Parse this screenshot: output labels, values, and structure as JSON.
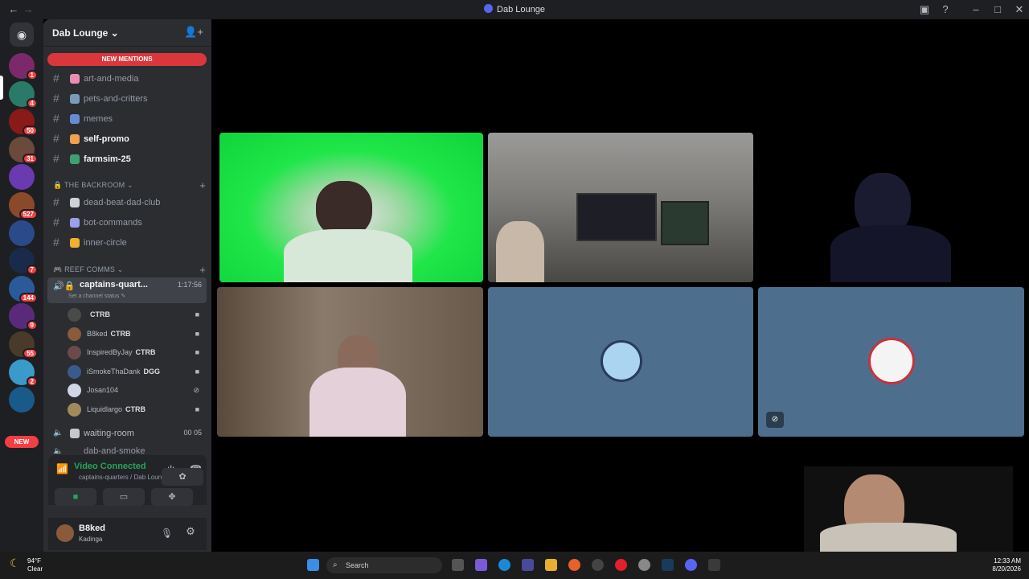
{
  "window": {
    "title": "Dab Lounge"
  },
  "servers": [
    {
      "badge": "1",
      "color": "#7a2a6a"
    },
    {
      "badge": "4",
      "color": "#2a7a6a"
    },
    {
      "badge": "50",
      "color": "#8a1a1a"
    },
    {
      "badge": "31",
      "color": "#6a4a3a"
    },
    {
      "badge": "",
      "color": "#6a3ab0"
    },
    {
      "badge": "527",
      "color": "#8a4a2a"
    },
    {
      "badge": "",
      "color": "#2a4a8a"
    },
    {
      "badge": "7",
      "color": "#1a2a4a"
    },
    {
      "badge": "144",
      "color": "#2a5a9a"
    },
    {
      "badge": "9",
      "color": "#5a2a7a"
    },
    {
      "badge": "55",
      "color": "#4a3a2a"
    },
    {
      "badge": "2",
      "color": "#3a9aca"
    },
    {
      "badge": "",
      "color": "#1a5a8a"
    }
  ],
  "rail": {
    "new_label": "NEW"
  },
  "guild": {
    "name": "Dab Lounge ⌄"
  },
  "new_mentions": "NEW MENTIONS",
  "channels_top": [
    {
      "name": "art-and-media",
      "emoji_color": "#e78fb3"
    },
    {
      "name": "pets-and-critters",
      "emoji_color": "#7a9ab8"
    },
    {
      "name": "memes",
      "emoji_color": "#6a8ad8"
    },
    {
      "name": "self-promo",
      "emoji_color": "#f0a050"
    },
    {
      "name": "farmsim-25",
      "emoji_color": "#40a070"
    }
  ],
  "category_backroom": "THE BACKROOM ⌄",
  "channels_backroom": [
    {
      "name": "dead-beat-dad-club",
      "emoji_color": "#cfd3d8"
    },
    {
      "name": "bot-commands",
      "emoji_color": "#9a9fe8"
    },
    {
      "name": "inner-circle",
      "emoji_color": "#f0b030"
    }
  ],
  "category_reef": "REEF COMMS ⌄",
  "voice_channel": {
    "name": "captains-quart...",
    "time": "1:17:56",
    "status": "Set a channel status ✎"
  },
  "voice_users": [
    {
      "name": "",
      "tag": "CTRB",
      "avatar": "#4a4a4a"
    },
    {
      "name": "B8ked",
      "tag": "CTRB",
      "avatar": "#8a5a3c"
    },
    {
      "name": "InspiredByJay",
      "tag": "CTRB",
      "avatar": "#6a4a4a"
    },
    {
      "name": "iSmokeThaDank",
      "tag": "DGG",
      "avatar": "#3a5a8a"
    },
    {
      "name": "Josan104",
      "tag": "",
      "avatar": "#d0d6e6"
    },
    {
      "name": "Liquidlargo",
      "tag": "CTRB",
      "avatar": "#a08a5a"
    }
  ],
  "waiting_room": {
    "name": "waiting-room",
    "time": "00 05"
  },
  "dab_smoke": "dab-and-smoke",
  "voice_bar": {
    "connected": "Video Connected",
    "sub": "captains-quarters / Dab Lounge"
  },
  "user": {
    "name": "B8ked",
    "status": "Kadinga"
  },
  "taskbar": {
    "weather_temp": "94°F",
    "weather_desc": "Clear",
    "search_placeholder": "Search",
    "time": "12:33 AM",
    "date": "8/20/2026"
  }
}
